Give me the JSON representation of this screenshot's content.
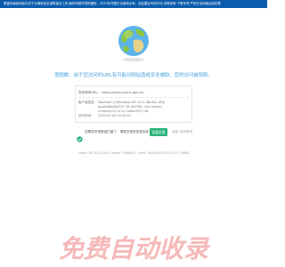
{
  "ticker": {
    "text": "根据河南省网信办关于为网络安全保障重点工作/维护网络环境的通知，2022年开展打击网络水军、谣言整治专项行动 详情咨询 下载专项 严厉打击网络谣言犯罪"
  },
  "message": {
    "text": "很抱歉，由于您访问的URL有可能对网站造成安全威胁，您的访问被阻断。"
  },
  "panel": {
    "url_label": "您的请求URL：",
    "url_value": "https://www.yuanz.gov.cn/",
    "ua_label": "客户端信息：",
    "ua_value": "Mozilla/5.0 (Windows NT 10.0; Win64; x64) AppleWebKit/537.36 (KHTML, like Gecko) Chrome/112.0.0.0 Safari/537.36",
    "time_label": "访问时间：",
    "time_value": "2024-07-29 15:42:21"
  },
  "actions": {
    "misjudge_text": "如果您觉得被误拦截了，请提交相关信息给我们，我们会尽快处理",
    "feedback_label": "误报反馈",
    "return_label": "返回",
    "home_label": "访问首页"
  },
  "footer": {
    "id_text": "client: 39.152.214.41, server: 35fe4d27, time: 29/Jul/2024:15:42:21 +0800"
  },
  "watermark": {
    "text": "免费自动收录",
    "color": "#f08080"
  },
  "colors": {
    "ticker_bg": "#0b5cad",
    "accent": "#4aa3df",
    "button": "#29b27a"
  }
}
